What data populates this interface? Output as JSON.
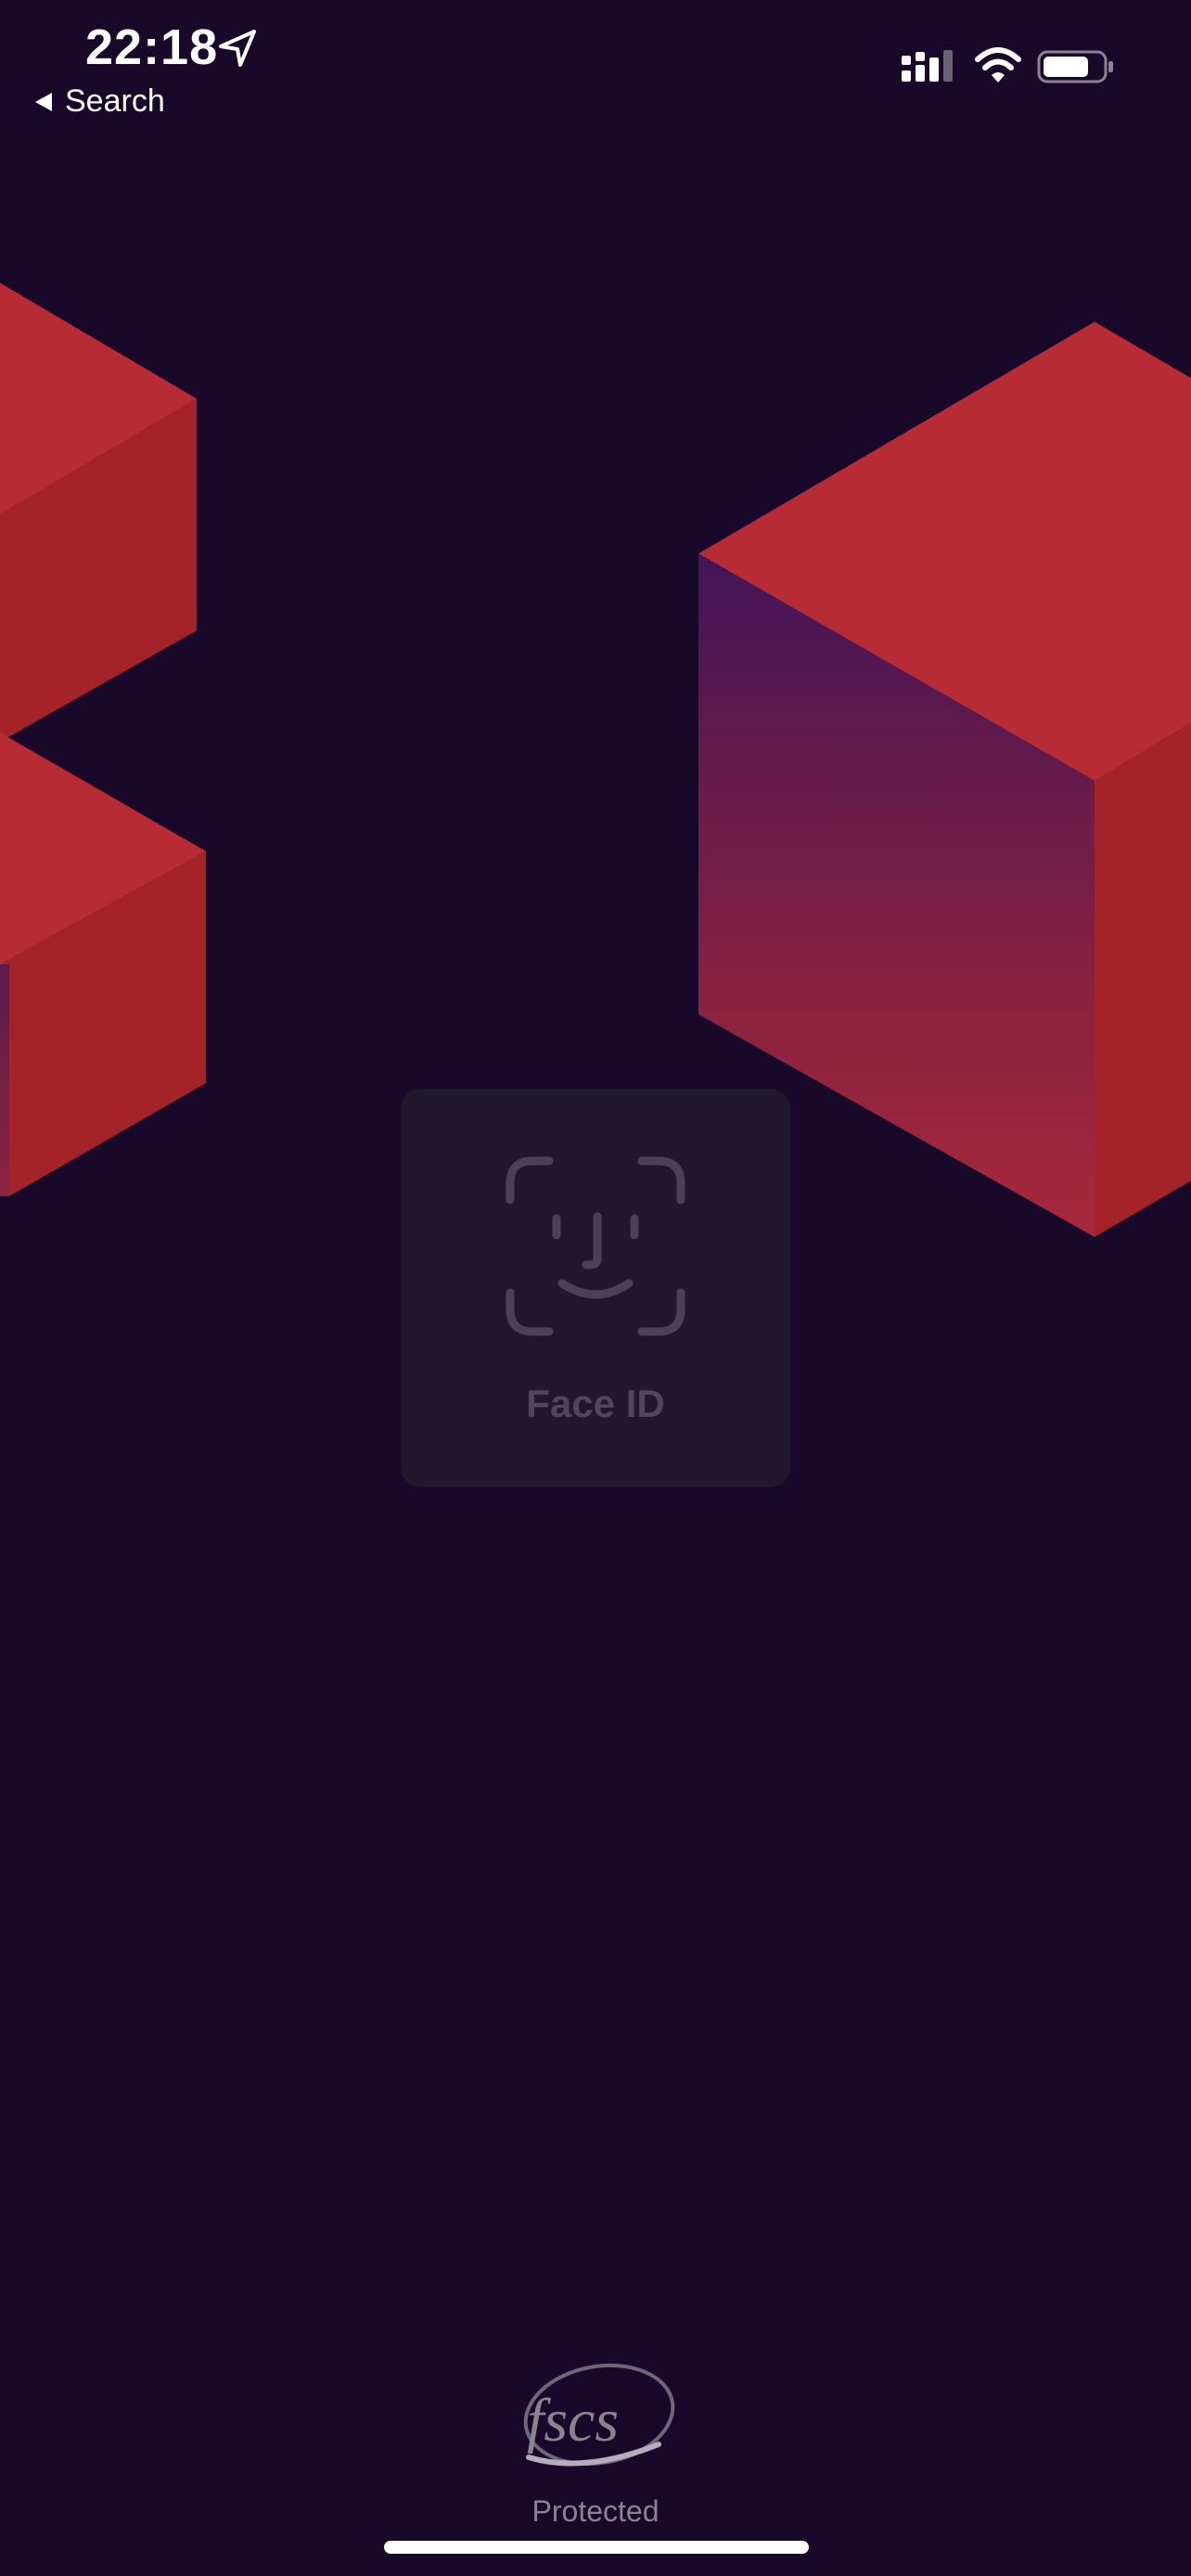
{
  "status_bar": {
    "time": "22:18",
    "back_label": "Search",
    "icons": [
      "location-arrow-icon",
      "signal-icon",
      "wifi-icon",
      "battery-icon"
    ]
  },
  "faceid": {
    "label": "Face ID",
    "icon": "face-id-icon"
  },
  "footer": {
    "logo_text": "fscs",
    "protected_label": "Protected"
  },
  "colors": {
    "background": "#180829",
    "cube_red": "#b72b34",
    "cube_dark_red": "#a42329",
    "cube_purple": "#421557",
    "dialog": "#21182d",
    "dialog_text": "#4f4659"
  }
}
